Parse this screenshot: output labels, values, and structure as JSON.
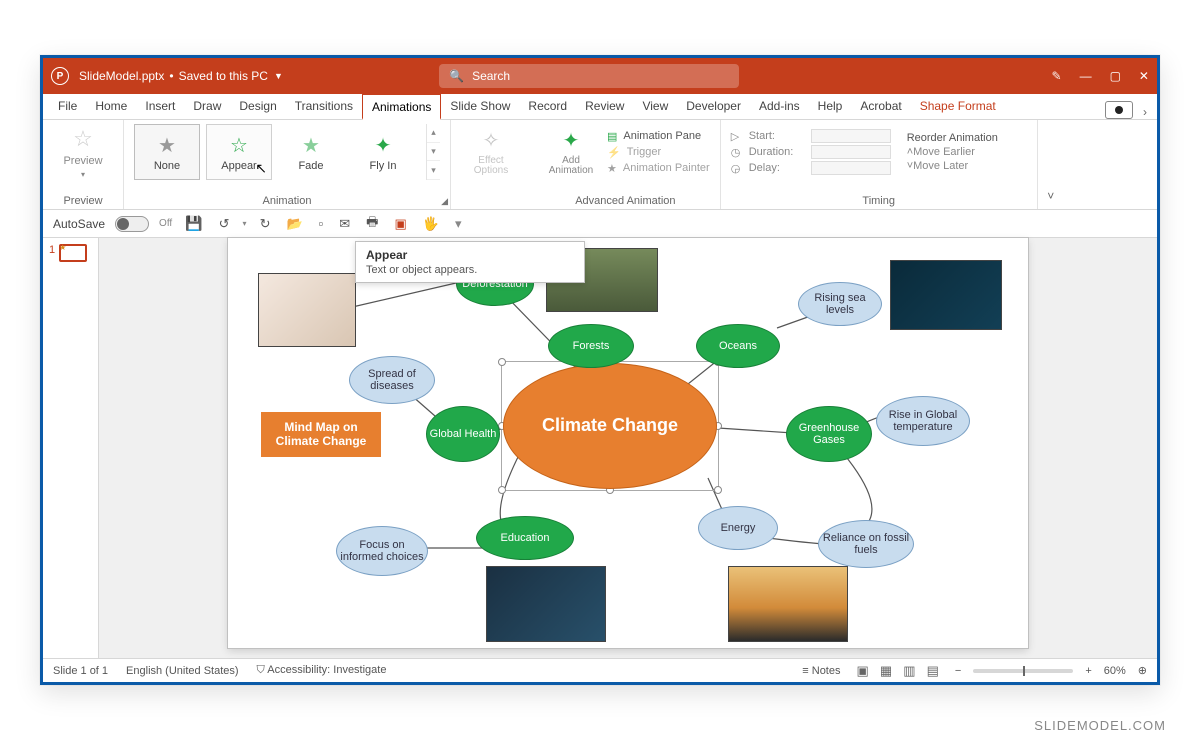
{
  "title": {
    "filename": "SlideModel.pptx",
    "save_state": "Saved to this PC",
    "search_placeholder": "Search"
  },
  "tabs": {
    "file": "File",
    "home": "Home",
    "insert": "Insert",
    "draw": "Draw",
    "design": "Design",
    "transitions": "Transitions",
    "animations": "Animations",
    "slideshow": "Slide Show",
    "record": "Record",
    "review": "Review",
    "view": "View",
    "developer": "Developer",
    "addins": "Add-ins",
    "help": "Help",
    "acrobat": "Acrobat",
    "shape_format": "Shape Format"
  },
  "ribbon": {
    "preview": {
      "button": "Preview",
      "group": "Preview"
    },
    "gallery": {
      "none": "None",
      "appear": "Appear",
      "fade": "Fade",
      "flyin": "Fly In",
      "group": "Animation"
    },
    "effect_options": "Effect Options",
    "add_anim": "Add Animation",
    "adv": {
      "pane": "Animation Pane",
      "trigger": "Trigger",
      "painter": "Animation Painter",
      "group": "Advanced Animation"
    },
    "timing": {
      "start": "Start:",
      "duration": "Duration:",
      "delay": "Delay:",
      "group": "Timing"
    },
    "reorder": {
      "title": "Reorder Animation",
      "earlier": "Move Earlier",
      "later": "Move Later"
    }
  },
  "qat": {
    "autosave": "AutoSave",
    "off": "Off"
  },
  "tooltip": {
    "title": "Appear",
    "body": "Text or object appears."
  },
  "mindmap": {
    "titlebox": "Mind Map on Climate Change",
    "center": "Climate Change",
    "forests": "Forests",
    "deforestation": "Deforestation",
    "oceans": "Oceans",
    "rising": "Rising sea levels",
    "health": "Global Health",
    "spread": "Spread of diseases",
    "greenhouse": "Greenhouse Gases",
    "rise_temp": "Rise in Global temperature",
    "education": "Education",
    "focus": "Focus on informed choices",
    "energy": "Energy",
    "reliance": "Reliance on fossil fuels"
  },
  "status": {
    "slide_of": "Slide 1 of 1",
    "lang": "English (United States)",
    "access": "Accessibility: Investigate",
    "notes": "Notes",
    "zoom": "60%"
  },
  "watermark": "SLIDEMODEL.COM"
}
